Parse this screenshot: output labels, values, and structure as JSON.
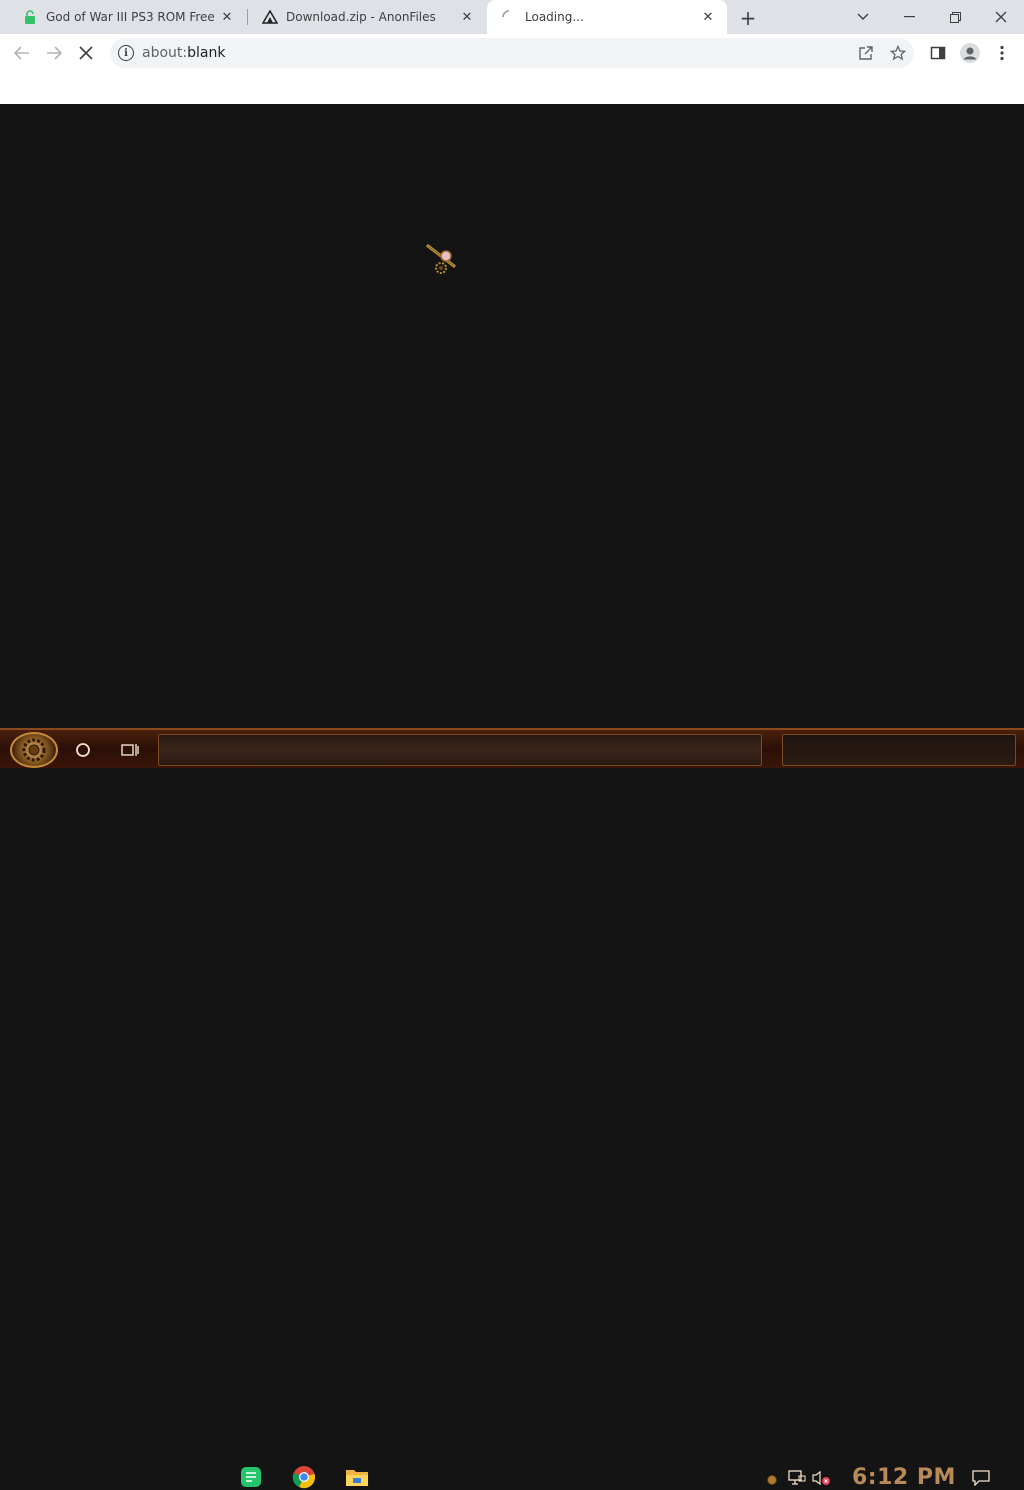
{
  "browser": {
    "tabs": [
      {
        "title": "God of War III PS3 ROM Free",
        "icon": "lock-favicon-icon",
        "active": false
      },
      {
        "title": "Download.zip - AnonFiles",
        "icon": "anonfiles-favicon-icon",
        "active": false
      },
      {
        "title": "Loading...",
        "icon": "loading-spinner-icon",
        "active": true
      }
    ],
    "new_tab_label": "+",
    "url": {
      "scheme": "about:",
      "rest": "blank"
    }
  },
  "taskbar": {
    "clock": "6:12 PM",
    "apps": [
      "notes-app-icon",
      "chrome-icon",
      "file-explorer-icon"
    ]
  },
  "colors": {
    "tabstrip": "#dee1e6",
    "content_bg": "#141414",
    "taskbar_accent": "#8a4a1e",
    "clock_text": "#b88a58"
  }
}
